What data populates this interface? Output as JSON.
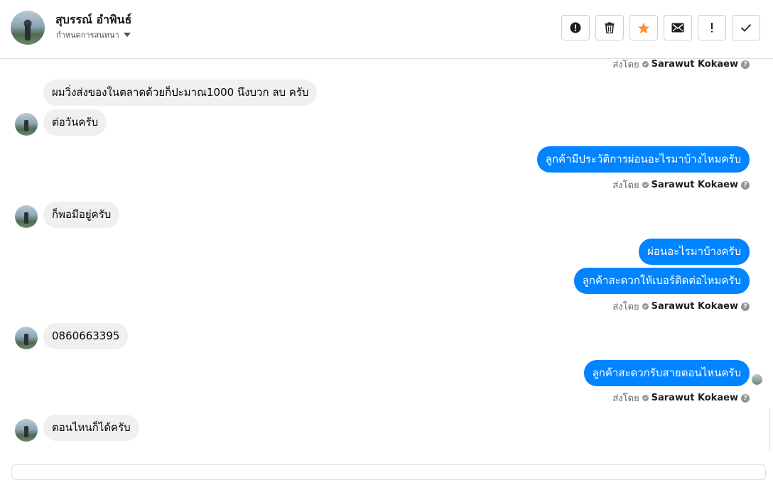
{
  "header": {
    "contact_name": "สุบรรณ์ อำพินธ์",
    "conversation_label": "กำหนดการสนทนา",
    "toolbar": [
      {
        "name": "mark-spam-button",
        "icon": "alert-circle-icon"
      },
      {
        "name": "delete-button",
        "icon": "trash-icon"
      },
      {
        "name": "star-button",
        "icon": "star-icon",
        "color": "#f7923b"
      },
      {
        "name": "mark-unread-button",
        "icon": "envelope-icon"
      },
      {
        "name": "mark-important-button",
        "icon": "exclamation-icon"
      },
      {
        "name": "mark-done-button",
        "icon": "check-icon"
      }
    ]
  },
  "thread": {
    "sent_by_label": "ส่งโดย",
    "sender_name": "Sarawut Kokaew",
    "messages": [
      {
        "dir": "in",
        "text": "ผมวิ่งส่งของในตลาดด้วยก็ปะมาณ1000 นึงบวก ลบ ครับ"
      },
      {
        "dir": "in",
        "text": "ต่อวันครับ"
      },
      {
        "dir": "out",
        "text": "ลูกค้ามีประวัติการผ่อนอะไรมาบ้างไหมครับ"
      },
      {
        "dir": "in",
        "text": "ก็พอมีอยู่ครับ"
      },
      {
        "dir": "out",
        "text": "ผ่อนอะไรมาบ้างครับ"
      },
      {
        "dir": "out",
        "text": "ลูกค้าสะดวกให้เบอร์ติดต่อไหมครับ"
      },
      {
        "dir": "in",
        "text": "0860663395"
      },
      {
        "dir": "out",
        "text": "ลูกค้าสะดวกรับสายตอนไหนครับ"
      },
      {
        "dir": "in",
        "text": "ตอนไหนก็ได้ครับ"
      }
    ]
  },
  "colors": {
    "outgoing_bubble": "#0084ff",
    "incoming_bubble": "#f0f0f0",
    "star": "#f7923b"
  }
}
